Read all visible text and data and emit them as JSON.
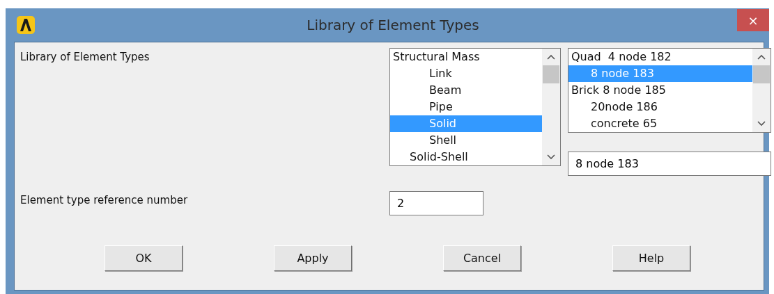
{
  "window": {
    "title": "Library of Element Types",
    "close": "×"
  },
  "library_label": "Library of Element Types",
  "category_list": {
    "items": [
      {
        "label": "Structural Mass",
        "kind": "group",
        "selected": false
      },
      {
        "label": "Link",
        "kind": "item",
        "selected": false
      },
      {
        "label": "Beam",
        "kind": "item",
        "selected": false
      },
      {
        "label": "Pipe",
        "kind": "item",
        "selected": false
      },
      {
        "label": "Solid",
        "kind": "item",
        "selected": true
      },
      {
        "label": "Shell",
        "kind": "item",
        "selected": false
      },
      {
        "label": "Solid-Shell",
        "kind": "subgroup",
        "selected": false
      }
    ]
  },
  "type_list": {
    "items": [
      {
        "label": "Quad  4 node 182",
        "kind": "group",
        "selected": false
      },
      {
        "label": "8 node 183",
        "kind": "item",
        "selected": true
      },
      {
        "label": "Brick 8 node 185",
        "kind": "group",
        "selected": false
      },
      {
        "label": "20node 186",
        "kind": "item",
        "selected": false
      },
      {
        "label": "concrete 65",
        "kind": "item",
        "selected": false
      }
    ]
  },
  "selection_field": {
    "value": "8 node 183"
  },
  "reference_label": "Element type reference number",
  "reference_field": {
    "value": "2"
  },
  "buttons": [
    "OK",
    "Apply",
    "Cancel",
    "Help"
  ]
}
